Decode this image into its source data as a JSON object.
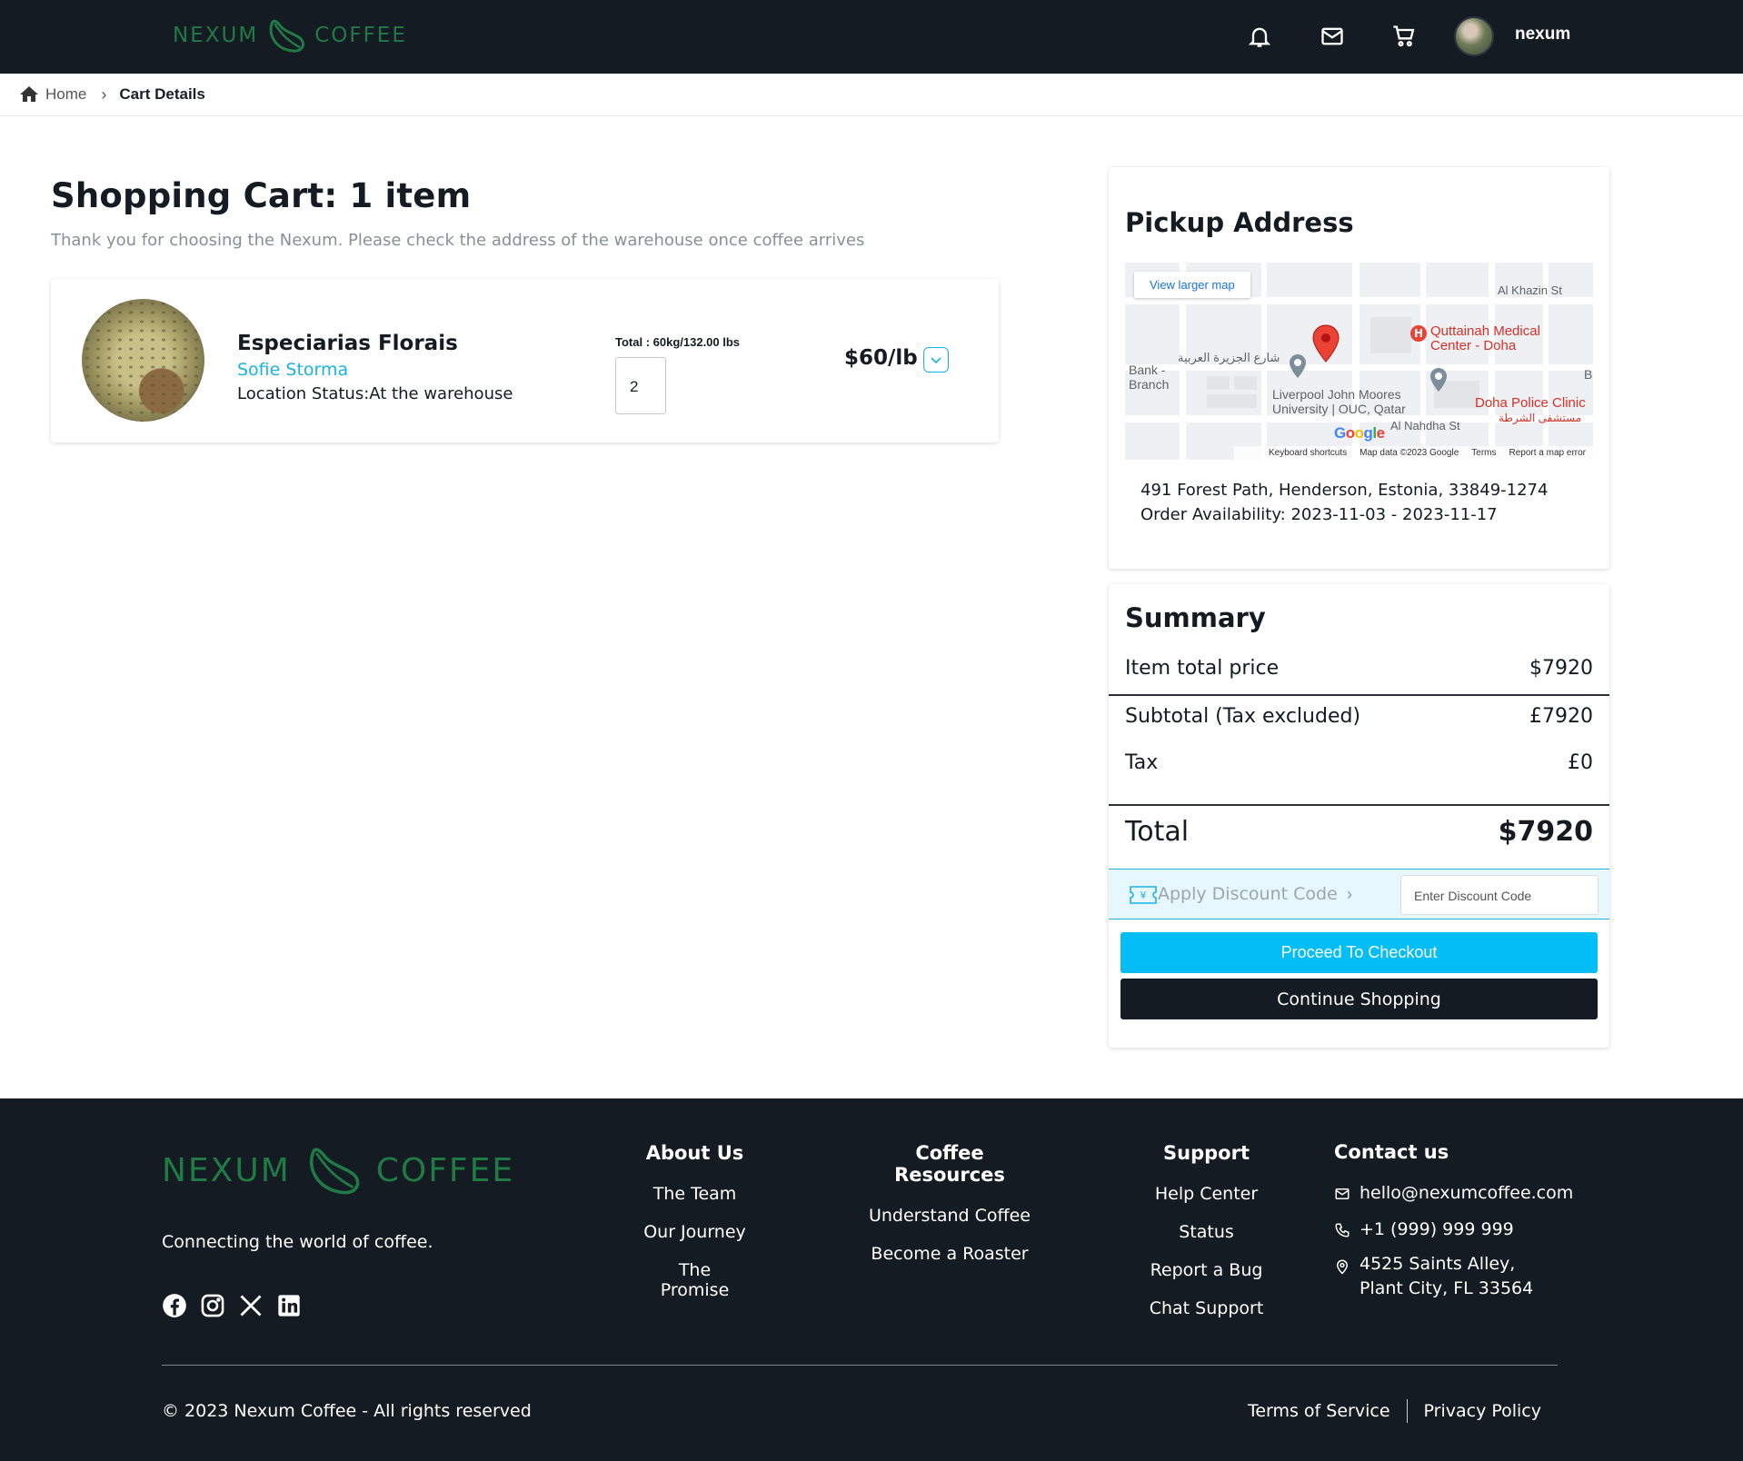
{
  "header": {
    "logo_left": "NEXUM",
    "logo_right": "COFFEE",
    "username": "nexum",
    "icons": [
      "bell-icon",
      "mail-icon",
      "cart-icon"
    ]
  },
  "breadcrumb": {
    "home": "Home",
    "current": "Cart Details"
  },
  "cart": {
    "title": "Shopping Cart: 1 item",
    "subtitle": "Thank you for choosing the Nexum. Please check the address of the warehouse once coffee arrives",
    "items": [
      {
        "name": "Especiarias Florais",
        "roaster": "Sofie Storma",
        "status": "Location Status:At the warehouse",
        "total_label": "Total : 60kg/132.00 lbs",
        "quantity": "2",
        "price": "$60/lb"
      }
    ]
  },
  "pickup": {
    "title": "Pickup Address",
    "map": {
      "button": "View larger map",
      "labels": {
        "street1": "Al Khazin St",
        "medical": "Quttainah Medical\nCenter - Doha",
        "arabic_street": "شارع الجزيرة العربية",
        "bank": "Bank -\nBranch",
        "university": "Liverpool John Moores\nUniversity | OUC, Qatar",
        "police": "Doha Police Clinic",
        "police_ar": "مستشفى الشرطة",
        "nahdha": "Al Nahdha St",
        "b": "B",
        "google": "Google"
      },
      "footer": [
        "Keyboard shortcuts",
        "Map data ©2023 Google",
        "Terms",
        "Report a map error"
      ]
    },
    "address": "491 Forest Path, Henderson, Estonia, 33849-1274",
    "availability": "Order Availability: 2023-11-03 - 2023-11-17"
  },
  "summary": {
    "title": "Summary",
    "rows": [
      {
        "label": "Item total price",
        "value": "$7920"
      },
      {
        "label": "Subtotal (Tax excluded)",
        "value": "£7920"
      },
      {
        "label": "Tax",
        "value": "£0"
      }
    ],
    "total_label": "Total",
    "total_value": "$7920",
    "discount_label": "Apply Discount Code",
    "discount_placeholder": "Enter Discount Code",
    "checkout": "Proceed To Checkout",
    "continue": "Continue Shopping"
  },
  "footer": {
    "logo_left": "NEXUM",
    "logo_right": "COFFEE",
    "tagline": "Connecting the world of coffee.",
    "social": [
      "facebook-icon",
      "instagram-icon",
      "x-icon",
      "linkedin-icon"
    ],
    "about": {
      "title": "About Us",
      "links": [
        "The Team",
        "Our Journey",
        "The Promise"
      ]
    },
    "resources": {
      "title": "Coffee Resources",
      "links": [
        "Understand Coffee",
        "Become a Roaster"
      ]
    },
    "support": {
      "title": "Support",
      "links": [
        "Help Center",
        "Status",
        "Report a Bug",
        "Chat Support"
      ]
    },
    "contact": {
      "title": "Contact us",
      "email": "hello@nexumcoffee.com",
      "phone": "+1 (999) 999 999",
      "address_line1": "4525 Saints Alley,",
      "address_line2": "Plant City, FL 33564"
    },
    "copyright": "© 2023 Nexum Coffee - All rights reserved",
    "terms": "Terms of Service",
    "privacy": "Privacy Policy"
  }
}
